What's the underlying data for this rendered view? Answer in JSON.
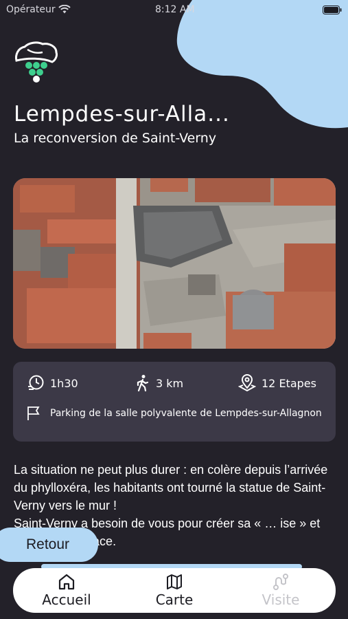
{
  "status_bar": {
    "carrier": "Opérateur",
    "time": "8:12 AM"
  },
  "header": {
    "title": "Lempdes-sur-Alla...",
    "subtitle": "La reconversion de Saint-Verny"
  },
  "info": {
    "duration": "1h30",
    "distance": "3 km",
    "steps": "12 Etapes",
    "parking": "Parking de la salle polyvalente de Lempdes-sur-Allagnon"
  },
  "description": {
    "line1": "La situation ne peut plus durer : en colère depuis l’arrivée du phylloxéra, les habitants ont tourné la statue de Saint-Verny vers le mur !",
    "line2": "Saint-Verny a besoin de vous pour créer sa « … ise » et retrouver sa place."
  },
  "buttons": {
    "back_label": "Retour"
  },
  "navbar": {
    "home_label": "Accueil",
    "map_label": "Carte",
    "visit_label": "Visite"
  },
  "colors": {
    "background": "#232129",
    "accent": "#b3d8f5",
    "card": "#3c3947",
    "logo_green": "#3ecf8e"
  },
  "icons": {
    "logo": "grapes-hat-logo",
    "duration": "clock-icon",
    "distance": "hiker-icon",
    "steps": "map-pin-icon",
    "parking": "flag-icon",
    "home": "house-icon",
    "map": "map-icon",
    "visit": "route-icon"
  }
}
